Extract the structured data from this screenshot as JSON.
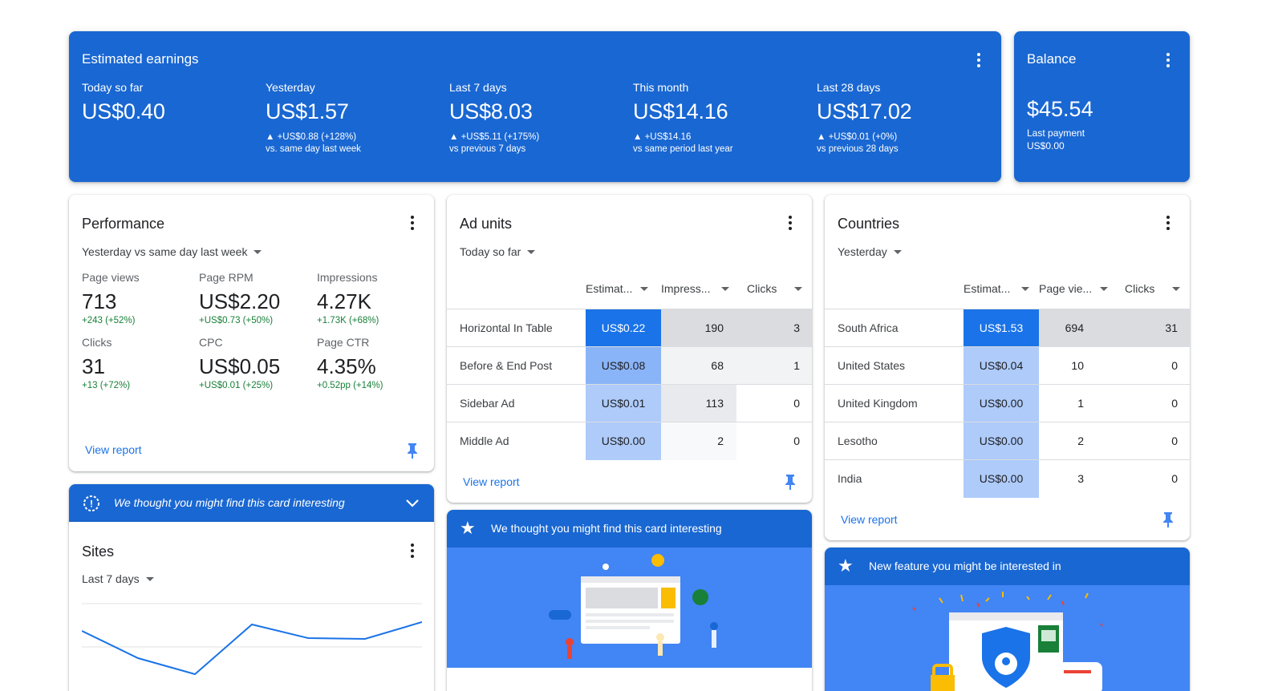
{
  "earnings": {
    "title": "Estimated earnings",
    "cols": [
      {
        "label": "Today so far",
        "value": "US$0.40",
        "change": "",
        "compare": ""
      },
      {
        "label": "Yesterday",
        "value": "US$1.57",
        "change": "▲ +US$0.88 (+128%)",
        "compare": "vs. same day last week"
      },
      {
        "label": "Last 7 days",
        "value": "US$8.03",
        "change": "▲ +US$5.11 (+175%)",
        "compare": "vs previous 7 days"
      },
      {
        "label": "This month",
        "value": "US$14.16",
        "change": "▲ +US$14.16",
        "compare": "vs same period last year"
      },
      {
        "label": "Last 28 days",
        "value": "US$17.02",
        "change": "▲ +US$0.01 (+0%)",
        "compare": "vs previous 28 days"
      }
    ]
  },
  "balance": {
    "title": "Balance",
    "value": "$45.54",
    "last_payment_label": "Last payment",
    "last_payment_value": "US$0.00"
  },
  "performance": {
    "title": "Performance",
    "range": "Yesterday vs same day last week",
    "metrics": [
      {
        "label": "Page views",
        "value": "713",
        "change": "+243 (+52%)"
      },
      {
        "label": "Page RPM",
        "value": "US$2.20",
        "change": "+US$0.73 (+50%)"
      },
      {
        "label": "Impressions",
        "value": "4.27K",
        "change": "+1.73K (+68%)"
      },
      {
        "label": "Clicks",
        "value": "31",
        "change": "+13 (+72%)"
      },
      {
        "label": "CPC",
        "value": "US$0.05",
        "change": "+US$0.01 (+25%)"
      },
      {
        "label": "Page CTR",
        "value": "4.35%",
        "change": "+0.52pp (+14%)"
      }
    ],
    "view_report": "View report"
  },
  "interesting_collapsed": {
    "text": "We thought you might find this card interesting"
  },
  "sites": {
    "title": "Sites",
    "range": "Last 7 days"
  },
  "ad_units": {
    "title": "Ad units",
    "range": "Today so far",
    "headers": [
      "Estimat...",
      "Impress...",
      "Clicks"
    ],
    "rows": [
      {
        "name": "Horizontal In Table",
        "earnings": "US$0.22",
        "impressions": "190",
        "clicks": "3"
      },
      {
        "name": "Before & End Post",
        "earnings": "US$0.08",
        "impressions": "68",
        "clicks": "1"
      },
      {
        "name": "Sidebar Ad",
        "earnings": "US$0.01",
        "impressions": "113",
        "clicks": "0"
      },
      {
        "name": "Middle Ad",
        "earnings": "US$0.00",
        "impressions": "2",
        "clicks": "0"
      }
    ],
    "view_report": "View report"
  },
  "interesting_ad": {
    "text": "We thought you might find this card interesting"
  },
  "countries": {
    "title": "Countries",
    "range": "Yesterday",
    "headers": [
      "Estimat...",
      "Page vie...",
      "Clicks"
    ],
    "rows": [
      {
        "name": "South Africa",
        "earnings": "US$1.53",
        "views": "694",
        "clicks": "31"
      },
      {
        "name": "United States",
        "earnings": "US$0.04",
        "views": "10",
        "clicks": "0"
      },
      {
        "name": "United Kingdom",
        "earnings": "US$0.00",
        "views": "1",
        "clicks": "0"
      },
      {
        "name": "Lesotho",
        "earnings": "US$0.00",
        "views": "2",
        "clicks": "0"
      },
      {
        "name": "India",
        "earnings": "US$0.00",
        "views": "3",
        "clicks": "0"
      }
    ],
    "view_report": "View report"
  },
  "new_feature": {
    "text": "New feature you might be interested in"
  },
  "colors": {
    "primary": "#1967d2",
    "link": "#1a73e8",
    "positive": "#188038",
    "heat_strong": "#1a73e8",
    "heat_light": "#aecbfa"
  }
}
